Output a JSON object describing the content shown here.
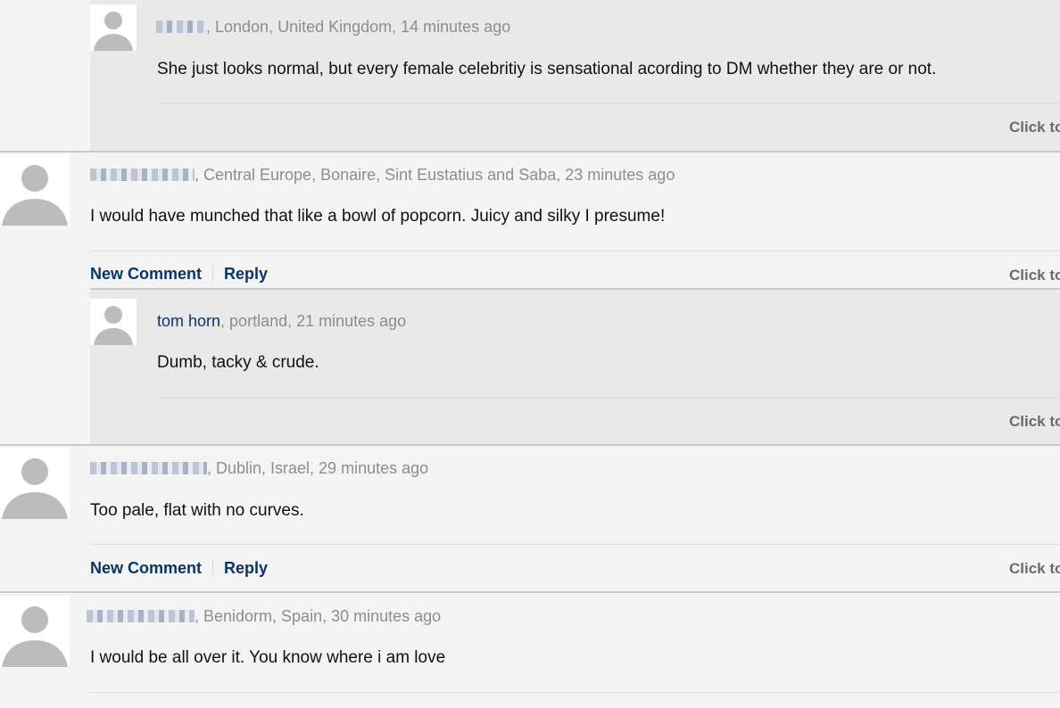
{
  "comments": [
    {
      "type": "reply",
      "location_time": ", London, United Kingdom, 14 minutes ago",
      "text": "She just looks normal, but every female celebritiy is sensational acording to DM whether they are or not.",
      "click_label": "Click to"
    },
    {
      "type": "top",
      "location_time": ", Central Europe, Bonaire, Sint Eustatius and Saba, 23 minutes ago",
      "text": "I would have munched that like a bowl of popcorn. Juicy and silky I presume!",
      "new_comment_label": "New Comment",
      "reply_label": "Reply",
      "click_label": "Click to"
    },
    {
      "type": "reply",
      "username": "tom horn",
      "location_time": ", portland, 21 minutes ago",
      "text": "Dumb, tacky & crude.",
      "click_label": "Click to"
    },
    {
      "type": "top",
      "location_time": ", Dublin, Israel, 29 minutes ago",
      "text": "Too pale, flat with no curves.",
      "new_comment_label": "New Comment",
      "reply_label": "Reply",
      "click_label": "Click to"
    },
    {
      "type": "top",
      "location_time": ", Benidorm, Spain, 30 minutes ago",
      "text": "I would be all over it. You know where i am love"
    }
  ]
}
